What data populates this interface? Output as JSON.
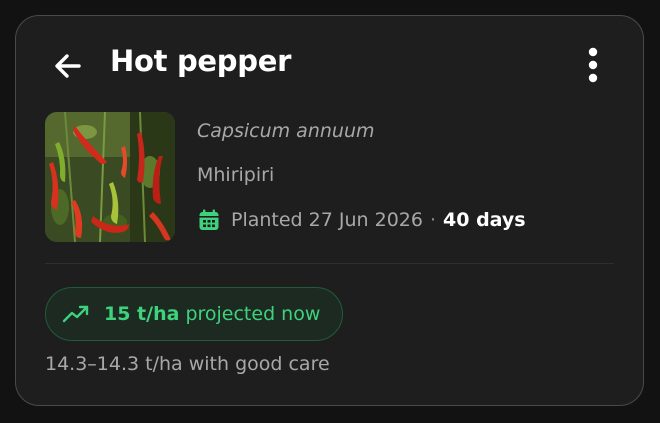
{
  "header": {
    "title": "Hot pepper",
    "back_icon": "arrow-left-icon",
    "menu_icon": "more-vertical-icon"
  },
  "crop": {
    "scientific_name": "Capsicum annuum",
    "local_name": "Mhiripiri",
    "planted_label": "Planted 27 Jun 2026",
    "separator": "·",
    "age": "40 days",
    "calendar_icon": "calendar-icon",
    "image_subject": "red and green chili peppers on plant"
  },
  "yield": {
    "value": "15 t/ha",
    "suffix": "projected now",
    "trend_icon": "trending-up-icon",
    "range_text": "14.3–14.3 t/ha with good care"
  },
  "colors": {
    "accent_green": "#3fd27c",
    "pill_border": "#1f5c3b",
    "card_bg": "#1e1e1e",
    "page_bg": "#121212"
  }
}
